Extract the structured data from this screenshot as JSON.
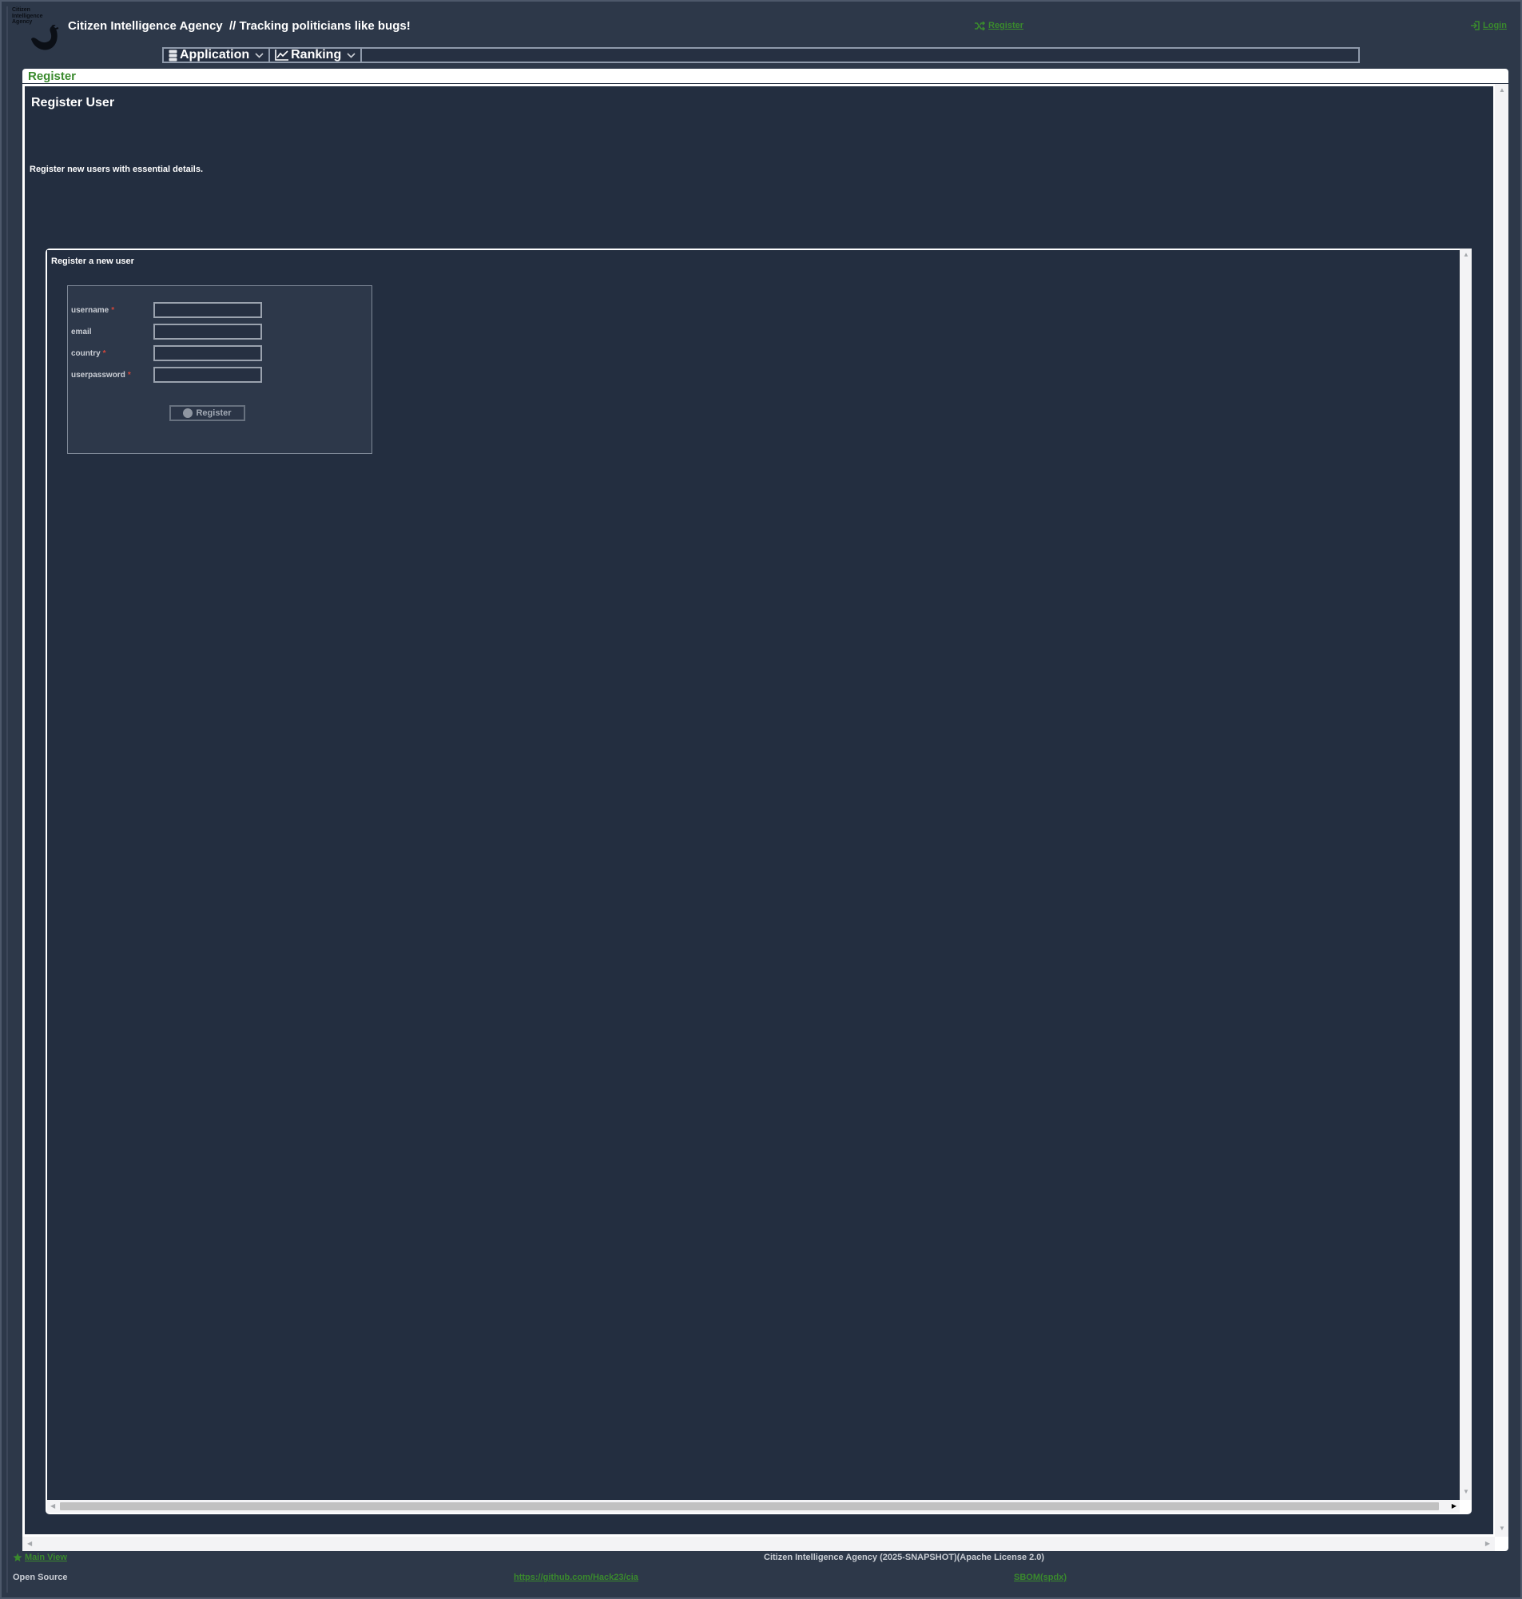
{
  "header": {
    "logo_text": "Citizen Intelligence Agency",
    "app_title": "Citizen Intelligence Agency  // Tracking politicians like bugs!",
    "register_link": "Register",
    "login_link": "Login"
  },
  "menu": {
    "items": [
      {
        "label": "Application",
        "icon": "server-icon"
      },
      {
        "label": "Ranking",
        "icon": "chart-line-icon"
      }
    ]
  },
  "tab": {
    "label": "Register"
  },
  "page": {
    "title": "Register User",
    "description": "Register new users with essential details."
  },
  "form_panel": {
    "title": "Register a new user",
    "fields": [
      {
        "label": "username",
        "required": true,
        "value": ""
      },
      {
        "label": "email",
        "required": false,
        "value": ""
      },
      {
        "label": "country",
        "required": true,
        "value": ""
      },
      {
        "label": "userpassword",
        "required": true,
        "value": ""
      }
    ],
    "required_marker": "*",
    "submit_label": "Register"
  },
  "footer": {
    "main_view": "Main View",
    "version": "Citizen Intelligence Agency (2025-SNAPSHOT)(Apache License 2.0)",
    "open_source": "Open Source",
    "github": "https://github.com/Hack23/cia",
    "sbom": "SBOM(spdx)"
  },
  "colors": {
    "background": "#232e40",
    "link_green": "#3a8a2d",
    "required_red": "#d3473a"
  }
}
